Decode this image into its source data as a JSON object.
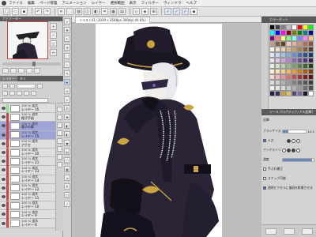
{
  "menubar": {
    "items": [
      "ファイル",
      "編集",
      "ページ管理",
      "アニメーション",
      "レイヤー",
      "選択範囲",
      "表示",
      "フィルター",
      "ウィンドウ",
      "ヘルプ"
    ]
  },
  "navigator": {
    "title": "ナビゲーター"
  },
  "layer_panel": {
    "tabs": [
      "レイヤー",
      "タイ"
    ],
    "layers": [
      {
        "mode": "100 % 通常",
        "name": "レイヤー 16",
        "selected": false
      },
      {
        "mode": "100 % 通常",
        "name": "帽子手前",
        "selected": false
      },
      {
        "mode": "100 % 通常",
        "name": "帽子の影",
        "selected": true
      },
      {
        "mode": "100 % 通常",
        "name": "レイヤー 15",
        "selected": true
      },
      {
        "mode": "100 % 通常",
        "name": "アクセ",
        "selected": false
      },
      {
        "mode": "100 % 通常",
        "name": "レイヤー 20",
        "selected": false
      },
      {
        "mode": "100 % 通常",
        "name": "レイヤー 21",
        "selected": false
      },
      {
        "mode": "100 % 通常",
        "name": "レイヤー 13",
        "selected": false
      },
      {
        "mode": "100 % 通常",
        "name": "レイヤー 14",
        "selected": false
      },
      {
        "mode": "100 % 通常",
        "name": "レイヤー 12",
        "selected": false
      },
      {
        "mode": "100 % 通常",
        "name": "レイヤー 11",
        "selected": false
      },
      {
        "mode": "100 % 通常",
        "name": "レイヤー 10",
        "selected": false
      },
      {
        "mode": "100 % 通常",
        "name": "レイヤー 9",
        "selected": false
      },
      {
        "mode": "100 % 通常",
        "name": "レイヤー 8",
        "selected": false
      }
    ]
  },
  "document": {
    "tab_title": "イラスト01 (2039 x 3548px 300dpi 40.6%)"
  },
  "color_panel": {
    "title": "カラーセット",
    "swatches": [
      "#000000",
      "#404040",
      "#808080",
      "#c0c0c0",
      "#ffffff",
      "#ff0000",
      "#ffff00",
      "#00ff00",
      "#00ffff",
      "#0000ff",
      "#ff00ff",
      "#800000",
      "#808000",
      "#008000",
      "#008080",
      "#000080",
      "#800080",
      "#ff8080",
      "#ffff80",
      "#80ff80",
      "#80ffff",
      "#8080ff",
      "#ff80ff",
      "#ffc080",
      "#c0a080",
      "#806040",
      "#604020",
      "#f0d0c0",
      "#e0b0a0",
      "#d09080",
      "#b07060",
      "#905040",
      "#f8f0e0",
      "#f0e0c8",
      "#e8d0b0",
      "#d8b890",
      "#c0a070",
      "#a08050",
      "#786040",
      "#504028",
      "#e0e8f8",
      "#c8d8f0",
      "#a8c0e8",
      "#88a8d8",
      "#6890c8",
      "#4870b0",
      "#305090",
      "#203870",
      "#f0e0f0",
      "#e0c8e8",
      "#c8a8d8",
      "#b088c8",
      "#9068b0",
      "#705090",
      "#503870",
      "#382050",
      "#e8f0e0",
      "#d0e0c8",
      "#b8d0a8",
      "#98b888",
      "#78a068",
      "#588048",
      "#406030",
      "#284020",
      "#fff0d8",
      "#ffe0b0",
      "#ffd090",
      "#ffb860",
      "#f09838",
      "#d07820",
      "#a85810",
      "#784008",
      "#f8d8d8",
      "#f0b8b8",
      "#e89898",
      "#d87070",
      "#c05050",
      "#a03838",
      "#802020",
      "#601010",
      "#dcdcdc",
      "#cfcfcf",
      "#b4b4b4",
      "#9c9c9c",
      "#848484",
      "#6c6c6c",
      "#545454",
      "#3c3c3c",
      "#f0f0f0",
      "#e4e4e4",
      "#d8d8d8",
      "#c8c8c8",
      "#b0b0b0",
      "#989898",
      "#707070",
      "#505050",
      "#2a2040",
      "#3a3060",
      "#c8a040",
      "#e0c060",
      "#5a4a80",
      "#7a6aa0",
      "#1a1428",
      "#ffffff"
    ]
  },
  "tool_property": {
    "title": "ツールプロパティ[リアル鉛筆]",
    "subtitle": "鉛筆",
    "brush_size_label": "ブラシサイズ",
    "brush_size_value": "10.2",
    "brush_size_fraction": 0.25,
    "pressure_label": "入力",
    "antialias_label": "アンチエイリアス",
    "density_label": "濃度",
    "density_fraction": 0.95,
    "stroke_label": "手ぶれ補正",
    "snap_label": "スナップ可能",
    "transparent_label": "透明ピクセルに描画を影響させる",
    "snap_checked": false,
    "transparent_checked": true
  }
}
